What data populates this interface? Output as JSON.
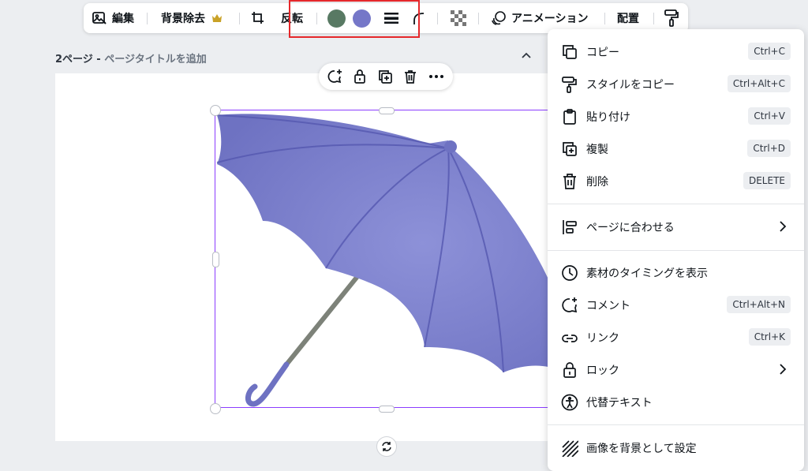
{
  "toolbar": {
    "edit_label": "編集",
    "bg_remove_label": "背景除去",
    "flip_label": "反転",
    "animate_label": "アニメーション",
    "position_label": "配置",
    "swatch_colors": [
      "#587963",
      "#7577c8"
    ]
  },
  "page": {
    "header_prefix": "2ページ - ",
    "header_placeholder": "ページタイトルを追加"
  },
  "context_menu": {
    "items": [
      {
        "label": "コピー",
        "shortcut": "Ctrl+C",
        "icon": "copy-icon"
      },
      {
        "label": "スタイルをコピー",
        "shortcut": "Ctrl+Alt+C",
        "icon": "paint-roller-icon"
      },
      {
        "label": "貼り付け",
        "shortcut": "Ctrl+V",
        "icon": "clipboard-icon"
      },
      {
        "label": "複製",
        "shortcut": "Ctrl+D",
        "icon": "duplicate-icon"
      },
      {
        "label": "削除",
        "shortcut": "DELETE",
        "icon": "trash-icon"
      },
      {
        "label": "ページに合わせる",
        "icon": "align-icon"
      },
      {
        "label": "素材のタイミングを表示",
        "icon": "clock-icon"
      },
      {
        "label": "コメント",
        "shortcut": "Ctrl+Alt+N",
        "icon": "comment-icon"
      },
      {
        "label": "リンク",
        "shortcut": "Ctrl+K",
        "icon": "link-icon"
      },
      {
        "label": "ロック",
        "icon": "lock-icon"
      },
      {
        "label": "代替テキスト",
        "icon": "accessibility-icon"
      },
      {
        "label": "画像を背景として設定",
        "icon": "hatch-icon"
      }
    ]
  },
  "colors": {
    "accent_selection": "#8b3dff",
    "highlight_box": "#e5282b",
    "umbrella": "#7a7fcf"
  }
}
